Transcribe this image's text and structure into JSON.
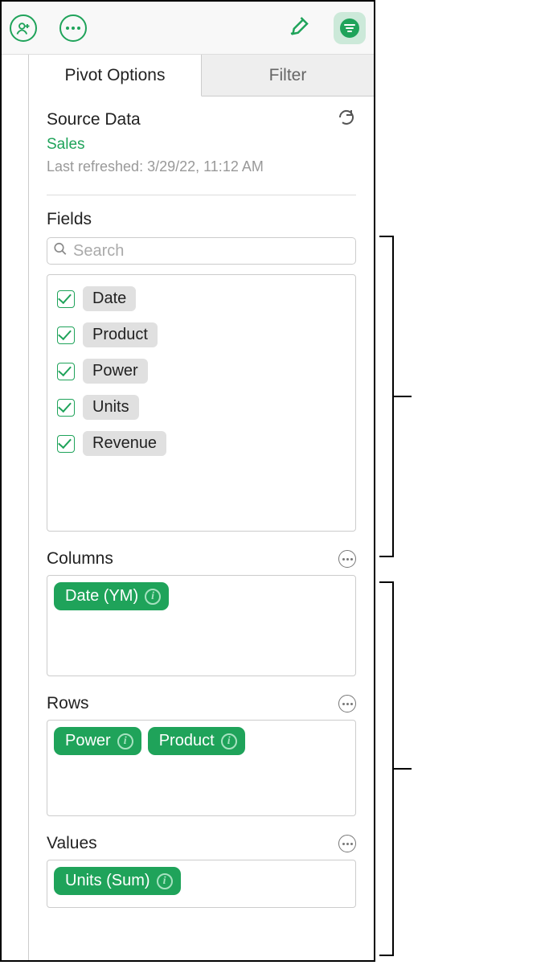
{
  "tabs": {
    "pivot": "Pivot Options",
    "filter": "Filter"
  },
  "source": {
    "heading": "Source Data",
    "name": "Sales",
    "refreshed": "Last refreshed: 3/29/22, 11:12 AM"
  },
  "fields": {
    "label": "Fields",
    "search_placeholder": "Search",
    "items": [
      "Date",
      "Product",
      "Power",
      "Units",
      "Revenue"
    ]
  },
  "columns": {
    "label": "Columns",
    "pills": [
      "Date (YM)"
    ]
  },
  "rows": {
    "label": "Rows",
    "pills": [
      "Power",
      "Product"
    ]
  },
  "values": {
    "label": "Values",
    "pills": [
      "Units (Sum)"
    ]
  }
}
